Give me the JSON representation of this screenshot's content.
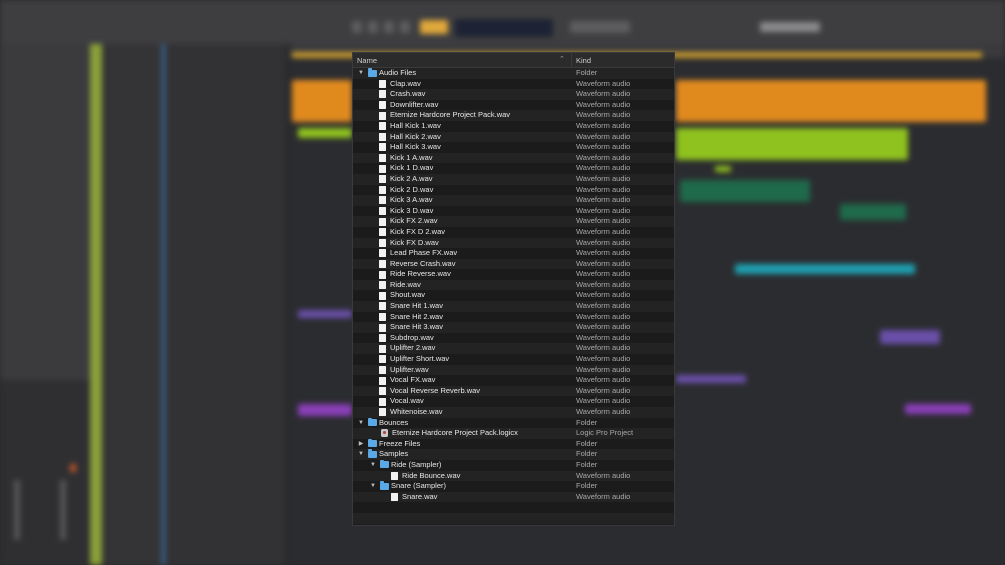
{
  "browser": {
    "columns": {
      "name": "Name",
      "kind": "Kind"
    },
    "sort_icon": "chevron-up-icon",
    "items": [
      {
        "name": "Audio Files",
        "kind": "Folder",
        "type": "folder",
        "level": 0,
        "expanded": true
      },
      {
        "name": "Clap.wav",
        "kind": "Waveform audio",
        "type": "file",
        "level": 1
      },
      {
        "name": "Crash.wav",
        "kind": "Waveform audio",
        "type": "file",
        "level": 1
      },
      {
        "name": "Downlifter.wav",
        "kind": "Waveform audio",
        "type": "file",
        "level": 1
      },
      {
        "name": "Eternize Hardcore Project Pack.wav",
        "kind": "Waveform audio",
        "type": "file",
        "level": 1
      },
      {
        "name": "Hall Kick 1.wav",
        "kind": "Waveform audio",
        "type": "file",
        "level": 1
      },
      {
        "name": "Hall Kick 2.wav",
        "kind": "Waveform audio",
        "type": "file",
        "level": 1
      },
      {
        "name": "Hall Kick 3.wav",
        "kind": "Waveform audio",
        "type": "file",
        "level": 1
      },
      {
        "name": "Kick 1 A.wav",
        "kind": "Waveform audio",
        "type": "file",
        "level": 1
      },
      {
        "name": "Kick 1 D.wav",
        "kind": "Waveform audio",
        "type": "file",
        "level": 1
      },
      {
        "name": "Kick 2 A.wav",
        "kind": "Waveform audio",
        "type": "file",
        "level": 1
      },
      {
        "name": "Kick 2 D.wav",
        "kind": "Waveform audio",
        "type": "file",
        "level": 1
      },
      {
        "name": "Kick 3 A.wav",
        "kind": "Waveform audio",
        "type": "file",
        "level": 1
      },
      {
        "name": "Kick 3 D.wav",
        "kind": "Waveform audio",
        "type": "file",
        "level": 1
      },
      {
        "name": "Kick FX 2.wav",
        "kind": "Waveform audio",
        "type": "file",
        "level": 1
      },
      {
        "name": "Kick FX D 2.wav",
        "kind": "Waveform audio",
        "type": "file",
        "level": 1
      },
      {
        "name": "Kick FX D.wav",
        "kind": "Waveform audio",
        "type": "file",
        "level": 1
      },
      {
        "name": "Lead Phase FX.wav",
        "kind": "Waveform audio",
        "type": "file",
        "level": 1
      },
      {
        "name": "Reverse Crash.wav",
        "kind": "Waveform audio",
        "type": "file",
        "level": 1
      },
      {
        "name": "Ride Reverse.wav",
        "kind": "Waveform audio",
        "type": "file",
        "level": 1
      },
      {
        "name": "Ride.wav",
        "kind": "Waveform audio",
        "type": "file",
        "level": 1
      },
      {
        "name": "Shout.wav",
        "kind": "Waveform audio",
        "type": "file",
        "level": 1
      },
      {
        "name": "Snare Hit 1.wav",
        "kind": "Waveform audio",
        "type": "file",
        "level": 1
      },
      {
        "name": "Snare Hit 2.wav",
        "kind": "Waveform audio",
        "type": "file",
        "level": 1
      },
      {
        "name": "Snare Hit 3.wav",
        "kind": "Waveform audio",
        "type": "file",
        "level": 1
      },
      {
        "name": "Subdrop.wav",
        "kind": "Waveform audio",
        "type": "file",
        "level": 1
      },
      {
        "name": "Uplifter 2.wav",
        "kind": "Waveform audio",
        "type": "file",
        "level": 1
      },
      {
        "name": "Uplifter Short.wav",
        "kind": "Waveform audio",
        "type": "file",
        "level": 1
      },
      {
        "name": "Uplifter.wav",
        "kind": "Waveform audio",
        "type": "file",
        "level": 1
      },
      {
        "name": "Vocal FX.wav",
        "kind": "Waveform audio",
        "type": "file",
        "level": 1
      },
      {
        "name": "Vocal Reverse Reverb.wav",
        "kind": "Waveform audio",
        "type": "file",
        "level": 1
      },
      {
        "name": "Vocal.wav",
        "kind": "Waveform audio",
        "type": "file",
        "level": 1
      },
      {
        "name": "Whitenoise.wav",
        "kind": "Waveform audio",
        "type": "file",
        "level": 1
      },
      {
        "name": "Bounces",
        "kind": "Folder",
        "type": "folder",
        "level": 0,
        "expanded": true
      },
      {
        "name": "Eternize Hardcore Project Pack.logicx",
        "kind": "Logic Pro Project",
        "type": "project",
        "level": 1
      },
      {
        "name": "Freeze Files",
        "kind": "Folder",
        "type": "folder",
        "level": 0,
        "expanded": false
      },
      {
        "name": "Samples",
        "kind": "Folder",
        "type": "folder",
        "level": 0,
        "expanded": true
      },
      {
        "name": "Ride (Sampler)",
        "kind": "Folder",
        "type": "folder",
        "level": 1,
        "expanded": true
      },
      {
        "name": "Ride Bounce.wav",
        "kind": "Waveform audio",
        "type": "file",
        "level": 2
      },
      {
        "name": "Snare (Sampler)",
        "kind": "Folder",
        "type": "folder",
        "level": 1,
        "expanded": true
      },
      {
        "name": "Snare.wav",
        "kind": "Waveform audio",
        "type": "file",
        "level": 2
      }
    ]
  },
  "colors": {
    "folder": "#5aa9e6",
    "region_orange": "#e08a1e",
    "region_green": "#8fc21f",
    "region_teal": "#1e9fb0",
    "region_purple": "#8a3fb8"
  }
}
